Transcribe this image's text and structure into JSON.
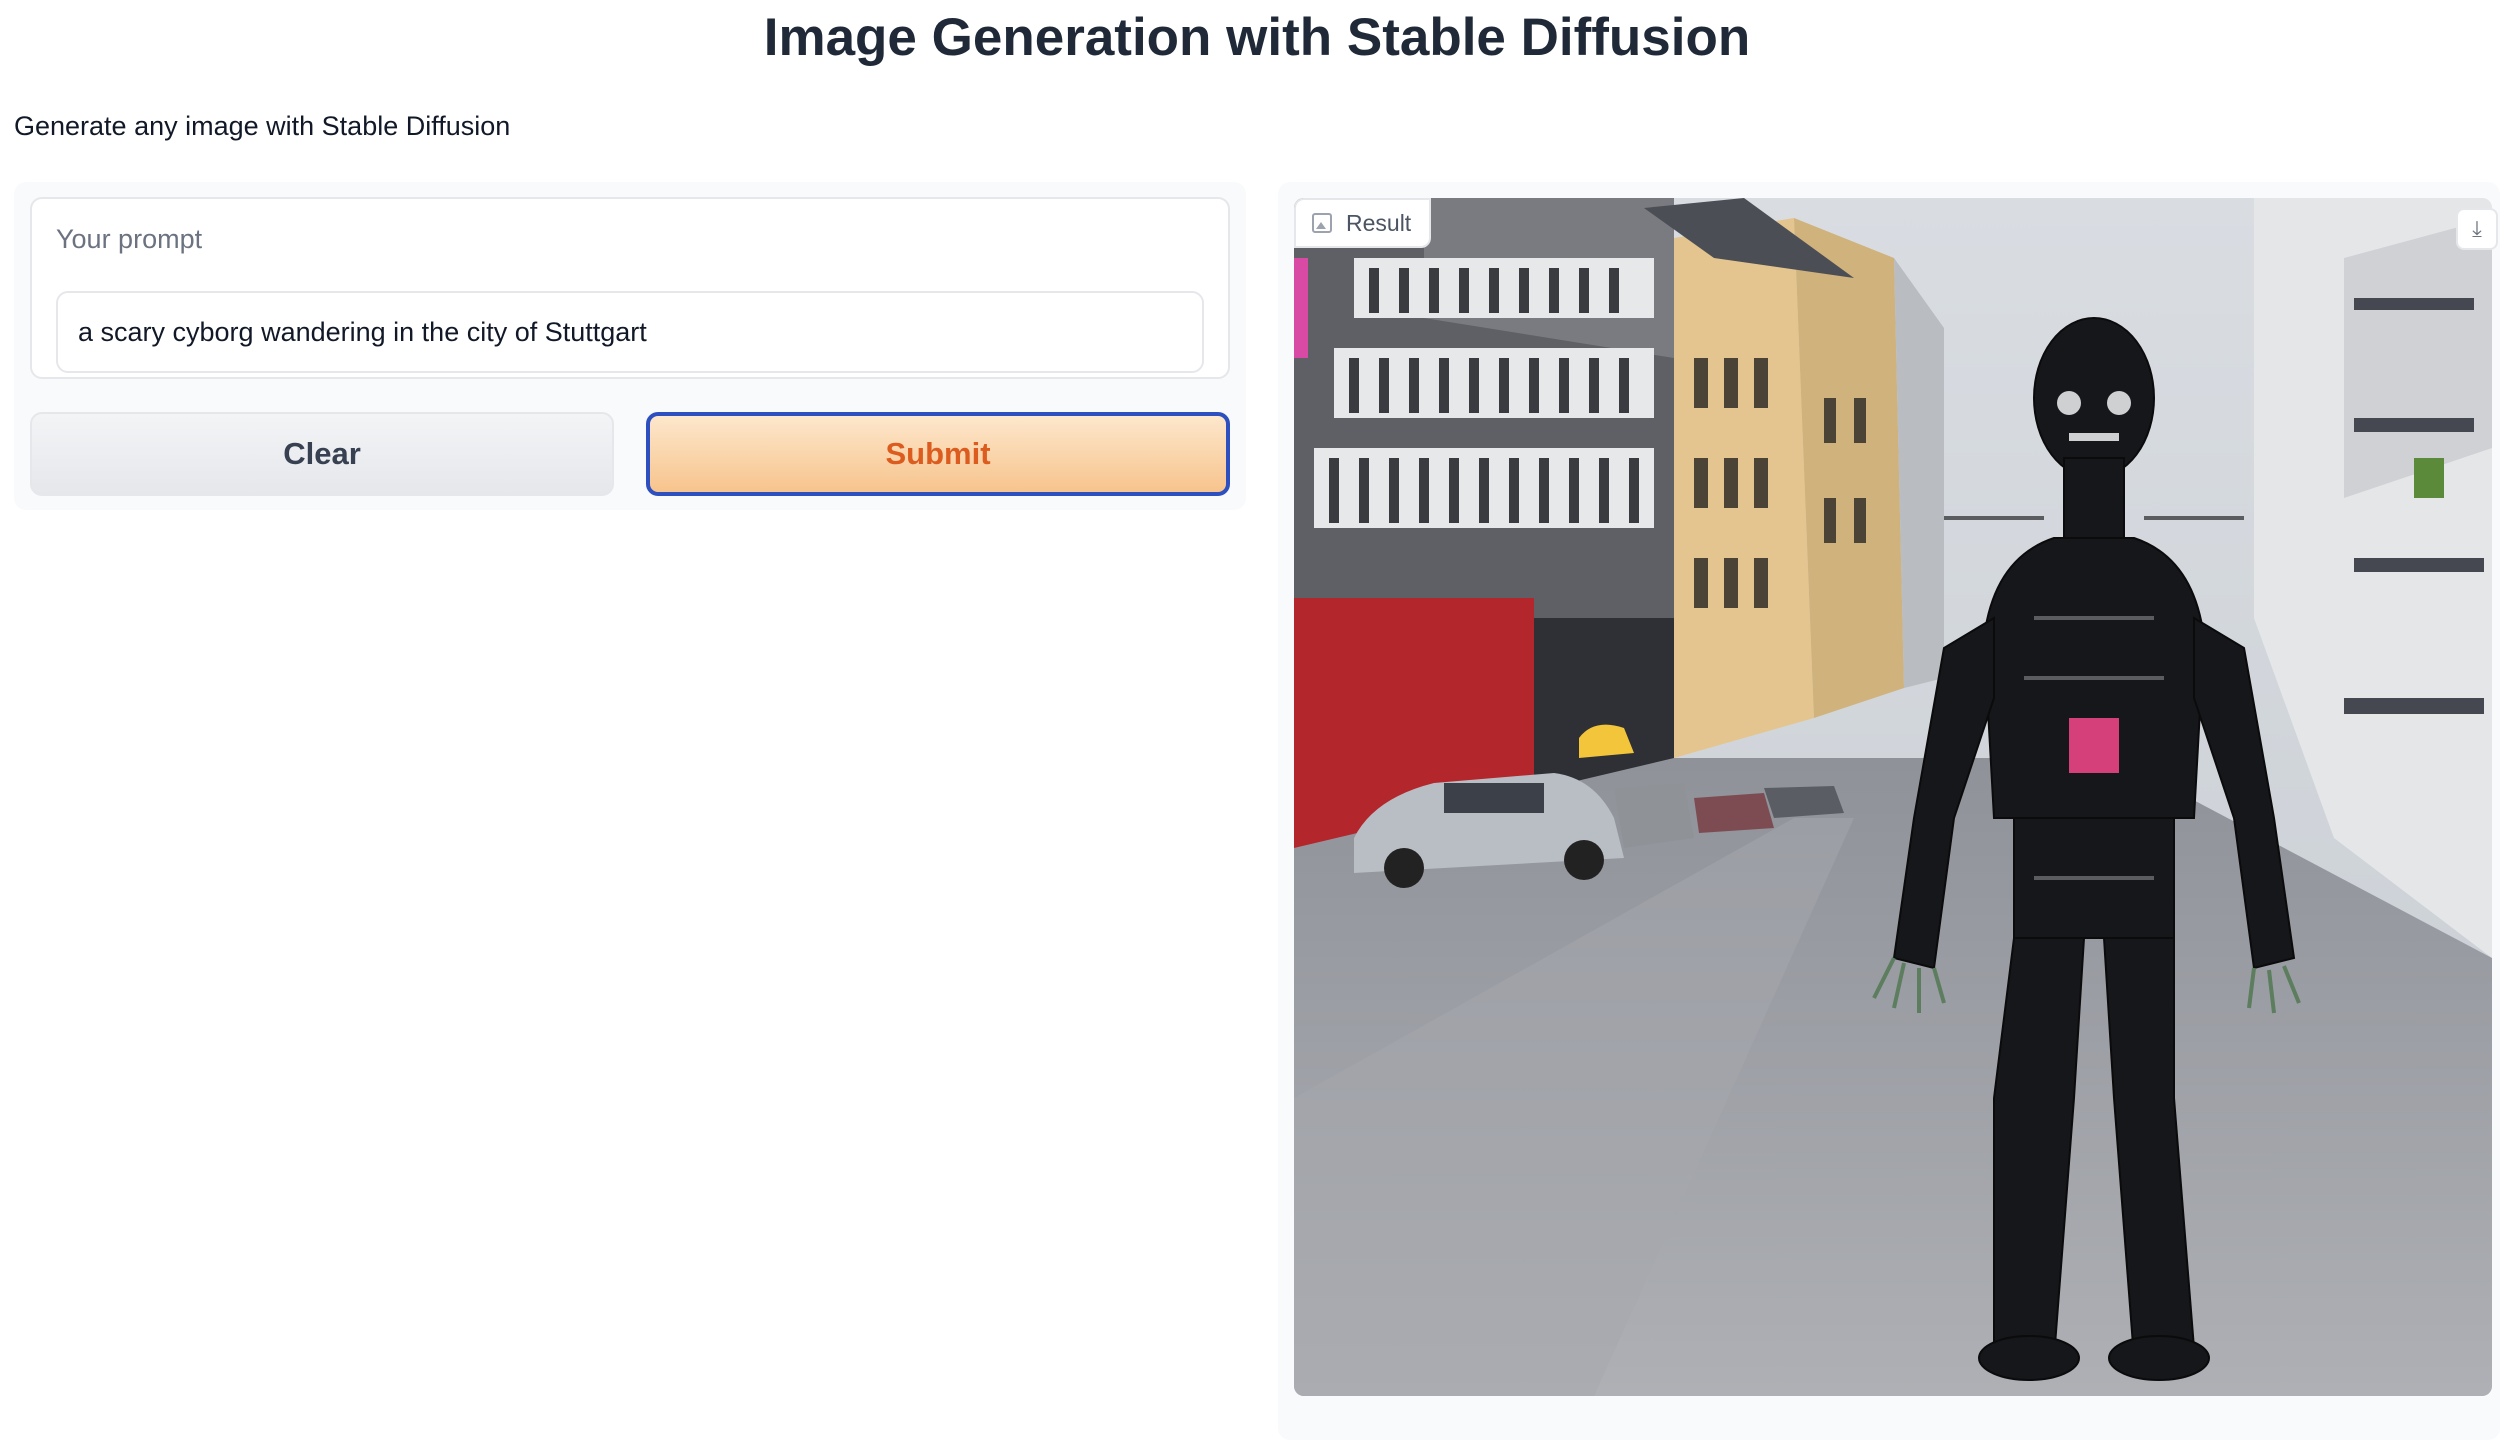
{
  "header": {
    "title": "Image Generation with Stable Diffusion",
    "description": "Generate any image with Stable Diffusion"
  },
  "prompt": {
    "label": "Your prompt",
    "value": "a scary cyborg wandering in the city of Stuttgart"
  },
  "buttons": {
    "clear_label": "Clear",
    "submit_label": "Submit"
  },
  "result": {
    "label": "Result",
    "download_icon": "download-icon",
    "image_icon": "image-icon"
  },
  "colors": {
    "submit_text": "#dc5c1f",
    "submit_border": "#2e4fbf",
    "submit_gradient_top": "#fde7cc",
    "submit_gradient_bottom": "#f7c48d"
  }
}
